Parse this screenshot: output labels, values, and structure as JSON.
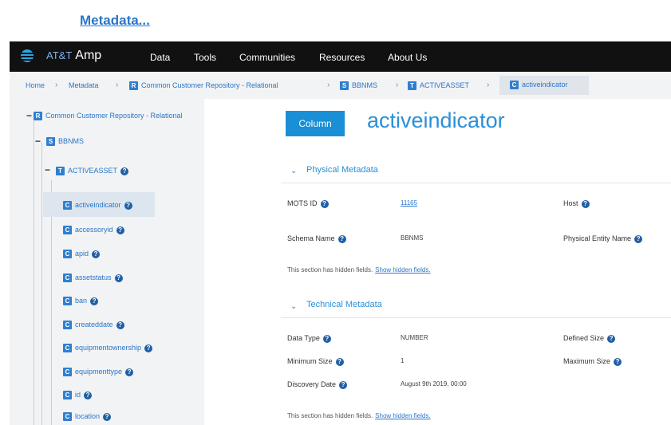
{
  "top_link": "Metadata...",
  "nav": {
    "brand_prefix": "AT&T",
    "brand_name": "Amp",
    "menu": [
      "Data",
      "Tools",
      "Communities",
      "Resources",
      "About Us"
    ]
  },
  "breadcrumb": [
    "Home",
    "Metadata",
    "Common Customer Repository - Relational",
    "BBNMS",
    "ACTIVEASSET",
    "activeindicator"
  ],
  "tree": {
    "root": "Common Customer Repository - Relational",
    "schema": "BBNMS",
    "table": "ACTIVEASSET",
    "columns": [
      "activeindicator",
      "accessoryid",
      "apid",
      "assetstatus",
      "ban",
      "createddate",
      "equipmentownership",
      "equipmenttype",
      "id",
      "location"
    ]
  },
  "main": {
    "badge": "Column",
    "title": "activeindicator",
    "physical": {
      "title": "Physical Metadata",
      "mots_label": "MOTS ID",
      "mots_value": "11165",
      "host_label": "Host",
      "schema_label": "Schema Name",
      "schema_value": "BBNMS",
      "entity_label": "Physical Entity Name",
      "note": "This section has hidden fields.",
      "note_link": "Show hidden fields."
    },
    "technical": {
      "title": "Technical Metadata",
      "data_type_label": "Data Type",
      "data_type_value": "NUMBER",
      "defined_size_label": "Defined Size",
      "min_size_label": "Minimum Size",
      "min_size_value": "1",
      "max_size_label": "Maximum Size",
      "discovery_label": "Discovery Date",
      "discovery_value": "August 9th 2019, 00:00",
      "note": "This section has hidden fields.",
      "note_link": "Show hidden fields."
    }
  }
}
